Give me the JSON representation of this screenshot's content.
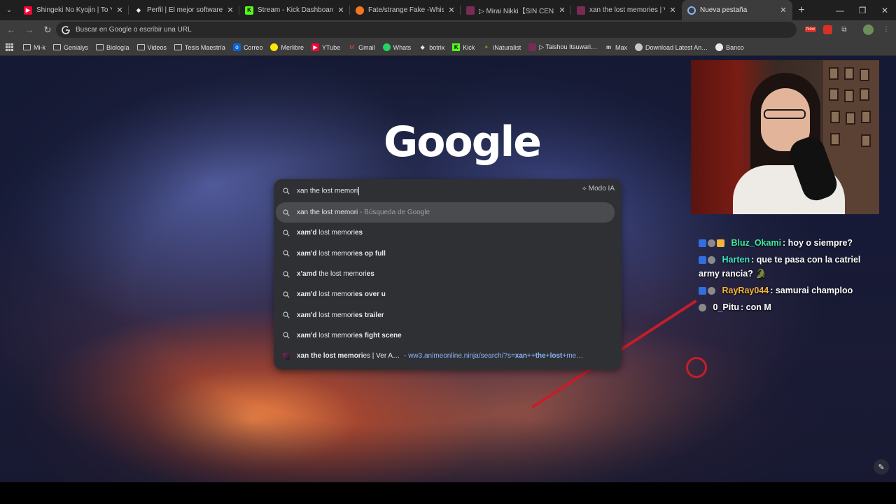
{
  "tabs": [
    {
      "title": "Shingeki No Kyojin | To Your Fr…",
      "favicon": "youtube-icon",
      "color": "#ff0033",
      "active": false
    },
    {
      "title": "Perfil | El mejor software para p…",
      "favicon": "diamond-icon",
      "color": "#e8eaed",
      "active": false
    },
    {
      "title": "Stream - Kick Dashboard",
      "favicon": "kick-icon",
      "color": "#53fc18",
      "active": false
    },
    {
      "title": "Fate/strange Fake -Whispers of…",
      "favicon": "crunchyroll-icon",
      "color": "#f47521",
      "active": false
    },
    {
      "title": "▷ Mirai Nikki【SIN CENSURA】…",
      "favicon": "anime-icon",
      "color": "#7a2b55",
      "active": false
    },
    {
      "title": "xan the lost memories | Ver An…",
      "favicon": "anime-icon",
      "color": "#7a2b55",
      "active": false
    },
    {
      "title": "Nueva pestaña",
      "favicon": "chrome-icon",
      "color": "#8ab4f8",
      "active": true
    }
  ],
  "omnibox": {
    "placeholder": "Buscar en Google o escribir una URL"
  },
  "bookmarks": [
    {
      "label": "Mi-k",
      "icon": "folder-icon"
    },
    {
      "label": "Genialys",
      "icon": "folder-icon"
    },
    {
      "label": "Biología",
      "icon": "folder-icon"
    },
    {
      "label": "Videos",
      "icon": "folder-icon"
    },
    {
      "label": "Tesis Maestría",
      "icon": "folder-icon"
    },
    {
      "label": "Correo",
      "icon": "outlook-icon"
    },
    {
      "label": "Merlibre",
      "icon": "mercadolibre-icon"
    },
    {
      "label": "YTube",
      "icon": "youtube-icon"
    },
    {
      "label": "Gmail",
      "icon": "gmail-icon"
    },
    {
      "label": "Whats",
      "icon": "whatsapp-icon"
    },
    {
      "label": "botrix",
      "icon": "botrix-icon"
    },
    {
      "label": "Kick",
      "icon": "kick-icon"
    },
    {
      "label": "iNaturalist",
      "icon": "inaturalist-icon"
    },
    {
      "label": "▷ Taishou Itsuwari…",
      "icon": "anime-icon"
    },
    {
      "label": "Max",
      "icon": "max-icon"
    },
    {
      "label": "Download Latest An…",
      "icon": "download-icon"
    },
    {
      "label": "Banco",
      "icon": "bank-icon"
    }
  ],
  "page": {
    "logo": "Google"
  },
  "search": {
    "query": "xan the lost memori",
    "modo_ia": "Modo IA",
    "first": {
      "text": "xan the lost memori",
      "sub": " - Búsqueda de Google"
    },
    "suggestions": [
      {
        "bold_pre": "xam'd",
        "normal": " lost memori",
        "bold_post": "es"
      },
      {
        "bold_pre": "xam'd",
        "normal": " lost memori",
        "bold_post": "es op full"
      },
      {
        "bold_pre": "x'amd",
        "normal": " the lost memori",
        "bold_post": "es"
      },
      {
        "bold_pre": "xam'd",
        "normal": " lost memori",
        "bold_post": "es over u"
      },
      {
        "bold_pre": "xam'd",
        "normal": " lost memori",
        "bold_post": "es trailer"
      },
      {
        "bold_pre": "xam'd",
        "normal": " lost memori",
        "bold_post": "es fight scene"
      }
    ],
    "history": {
      "bold": "xan the lost memori",
      "rest": "es | Ver A…",
      "url_pre": "- ww3.animeonline.ninja/search/?s=",
      "url_bold": "xan",
      "url_mid": "++",
      "url_bold2": "the",
      "url_plus": "+",
      "url_bold3": "lost",
      "url_plus2": "+",
      "url_tail": "me…"
    }
  },
  "chat": [
    {
      "user": "Bluz_Okami",
      "color": "#3ee6a0",
      "text": ": hoy o siempre?"
    },
    {
      "user": "Harten",
      "color": "#3ee6c2",
      "text": ": que te pasa con la catriel army rancia? 🐊"
    },
    {
      "user": "RayRay044",
      "color": "#f5b53a",
      "text": ": samurai champloo"
    },
    {
      "user": "0_Pitu",
      "color": "#ffffff",
      "text": ": con M"
    }
  ]
}
